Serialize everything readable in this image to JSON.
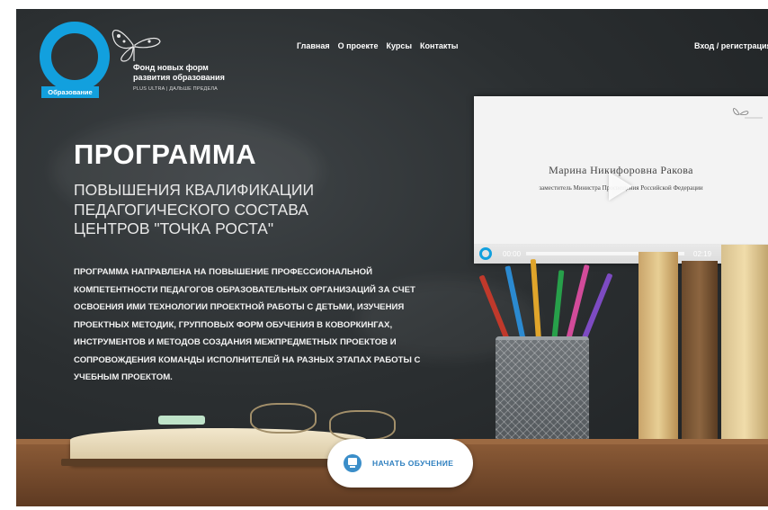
{
  "logo": {
    "icon": "ring-logo-icon",
    "tag": "Образование",
    "fund_title": "Фонд новых форм развития образования",
    "fund_sub": "PLUS ULTRA | ДАЛЬШЕ ПРЕДЕЛА",
    "accent": "#12a0de"
  },
  "nav": {
    "items": [
      "Главная",
      "О проекте",
      "Курсы",
      "Контакты"
    ],
    "login": "Вход / регистрация"
  },
  "hero": {
    "title": "ПРОГРАММА",
    "subtitle": "ПОВЫШЕНИЯ КВАЛИФИКАЦИИ ПЕДАГОГИЧЕСКОГО СОСТАВА ЦЕНТРОВ \"ТОЧКА РОСТА\"",
    "description": "ПРОГРАММА НАПРАВЛЕНА НА ПОВЫШЕНИЕ ПРОФЕССИОНАЛЬНОЙ КОМПЕТЕНТНОСТИ ПЕДАГОГОВ ОБРАЗОВАТЕЛЬНЫХ ОРГАНИЗАЦИЙ ЗА СЧЕТ ОСВОЕНИЯ ИМИ ТЕХНОЛОГИИ ПРОЕКТНОЙ РАБОТЫ С ДЕТЬМИ, ИЗУЧЕНИЯ ПРОЕКТНЫХ МЕТОДИК, ГРУППОВЫХ ФОРМ ОБУЧЕНИЯ В КОВОРКИНГАХ, ИНСТРУМЕНТОВ И МЕТОДОВ СОЗДАНИЯ МЕЖПРЕДМЕТНЫХ ПРОЕКТОВ И СОПРОВОЖДЕНИЯ КОМАНДЫ ИСПОЛНИТЕЛЕЙ НА РАЗНЫХ ЭТАПАХ РАБОТЫ С УЧЕБНЫМ ПРОЕКТОМ."
  },
  "video": {
    "speaker_name": "Марина Никифоровна Ракова",
    "speaker_role": "заместитель Министра Просвещения Российской Федерации",
    "current_time": "00:00",
    "duration": "02:19",
    "progress": 0
  },
  "cta": {
    "label": "НАЧАТЬ ОБУЧЕНИЕ",
    "icon": "screen-icon"
  }
}
